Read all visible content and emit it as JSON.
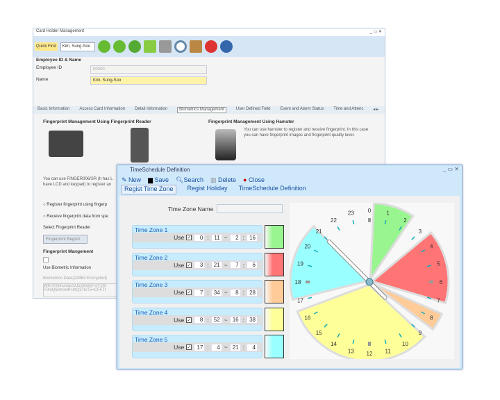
{
  "back": {
    "title": "Card Holder Management",
    "quick_find": "Quick Find",
    "quick_find_value": "Kim, Sung-Soo",
    "section": "Employee ID & Name",
    "employee_id_label": "Employee ID",
    "employee_id_value": "00000",
    "name_label": "Name",
    "name_value": "Kim, Sung-Soo",
    "tabs": [
      "Basic Information",
      "Access Card Information",
      "Detail Information",
      "Biometrics Management",
      "User Defined Field",
      "Event and Alarm Status",
      "Time and Attenc"
    ],
    "fp_reader_title": "Fingerprint Management Using Fingerprint Reader",
    "hamster_title": "Fingerprint Management Using Hamster",
    "hamster_text": "You can use hamster to register and receive fingerprint. In this case you can have fingerprint images and fingerprint quality level.",
    "reader_text": "You can use FINGER006/SR (It has L have LCD and keypad) to register an",
    "radio1": "Register fingerprint using fingerp",
    "radio2": "Receive fingerprint data from spe",
    "select_reader": "Select Fingerprint Reader",
    "register_btn": "Fingerprint Registr",
    "fp_mgmt": "Fingerprint Mangement",
    "use_bio": "Use Biometric Information",
    "bio_data": "Biometrics Data(128Bit Encrypted)",
    "bio_value": "Wt07f/miRZwyZ9J53Xxel0+oYcfH F0niQ6Am\\s4t+lhQ37lvT5+CFFTt"
  },
  "front": {
    "title": "TimeSchedule Definition",
    "toolbar": [
      "New",
      "Save",
      "Search",
      "Delete",
      "Close"
    ],
    "tabs": [
      "Regist Time Zone",
      "Regist Holiday",
      "TimeSchedule Definition"
    ],
    "tz_name_label": "Time Zone Name",
    "tz_name_value": "",
    "use_label": "Use",
    "zones": [
      {
        "name": "Time Zone 1",
        "start_h": "0",
        "start_m": "11",
        "end_h": "2",
        "end_m": "16",
        "color": "#99f58f"
      },
      {
        "name": "Time Zone 2",
        "start_h": "3",
        "start_m": "21",
        "end_h": "7",
        "end_m": "6",
        "color": "#ff7575"
      },
      {
        "name": "Time Zone 3",
        "start_h": "7",
        "start_m": "34",
        "end_h": "8",
        "end_m": "28",
        "color": "#ffcc99"
      },
      {
        "name": "Time Zone 4",
        "start_h": "8",
        "start_m": "52",
        "end_h": "16",
        "end_m": "38",
        "color": "#ffff99"
      },
      {
        "name": "Time Zone 5",
        "start_h": "17",
        "start_m": "4",
        "end_h": "21",
        "end_m": "4",
        "color": "#99ffff"
      }
    ],
    "hours": [
      "0",
      "1",
      "2",
      "3",
      "4",
      "5",
      "6",
      "7",
      "8",
      "9",
      "10",
      "11",
      "12",
      "13",
      "14",
      "15",
      "16",
      "17",
      "18",
      "19",
      "20",
      "21",
      "22",
      "23"
    ],
    "hand_hour": 21
  }
}
